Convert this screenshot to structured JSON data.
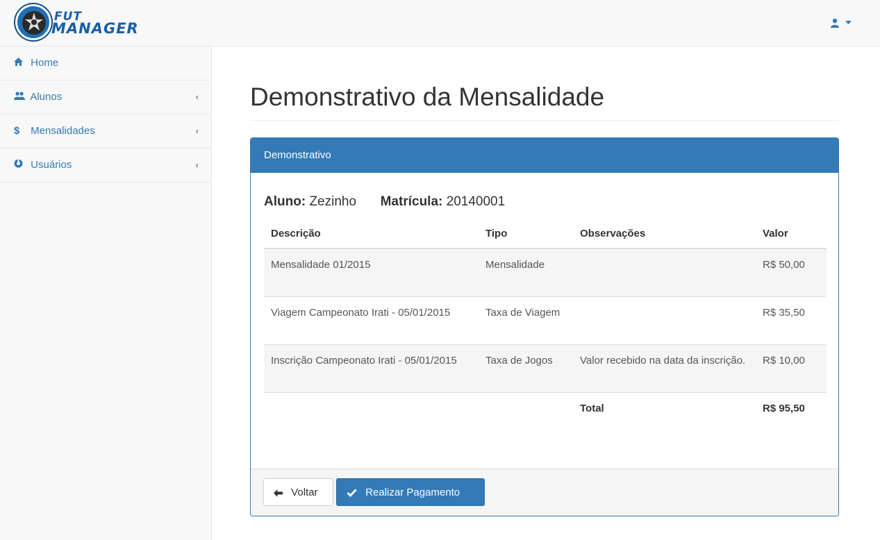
{
  "brand": {
    "line1": "FUT",
    "line2": "MANAGER"
  },
  "sidebar": {
    "items": [
      {
        "icon": "home-icon",
        "glyph": "⌂",
        "label": "Home",
        "has_arrow": false
      },
      {
        "icon": "users-icon",
        "glyph": "👥",
        "label": "Alunos",
        "has_arrow": true
      },
      {
        "icon": "dollar-icon",
        "glyph": "$",
        "label": "Mensalidades",
        "has_arrow": true
      },
      {
        "icon": "support-icon",
        "glyph": "◉",
        "label": "Usuários",
        "has_arrow": true
      }
    ],
    "arrow_glyph": "‹"
  },
  "page": {
    "title": "Demonstrativo da Mensalidade"
  },
  "panel": {
    "heading": "Demonstrativo",
    "student_label": "Aluno:",
    "student_name": "Zezinho",
    "enrollment_label": "Matrícula:",
    "enrollment_number": "20140001"
  },
  "table": {
    "headers": [
      "Descrição",
      "Tipo",
      "Observações",
      "Valor"
    ],
    "rows": [
      {
        "descricao": "Mensalidade 01/2015",
        "tipo": "Mensalidade",
        "obs": "",
        "valor": "R$ 50,00"
      },
      {
        "descricao": "Viagem Campeonato Irati - 05/01/2015",
        "tipo": "Taxa de Viagem",
        "obs": "",
        "valor": "R$ 35,50"
      },
      {
        "descricao": "Inscrição Campeonato Irati - 05/01/2015",
        "tipo": "Taxa de Jogos",
        "obs": "Valor recebido na data da inscrição.",
        "valor": "R$ 10,00"
      }
    ],
    "total_label": "Total",
    "total_value": "R$ 95,50"
  },
  "footer": {
    "back_label": "Voltar",
    "pay_label": "Realizar Pagamento"
  },
  "colors": {
    "primary": "#337ab7",
    "sidebar_bg": "#f8f8f8"
  }
}
